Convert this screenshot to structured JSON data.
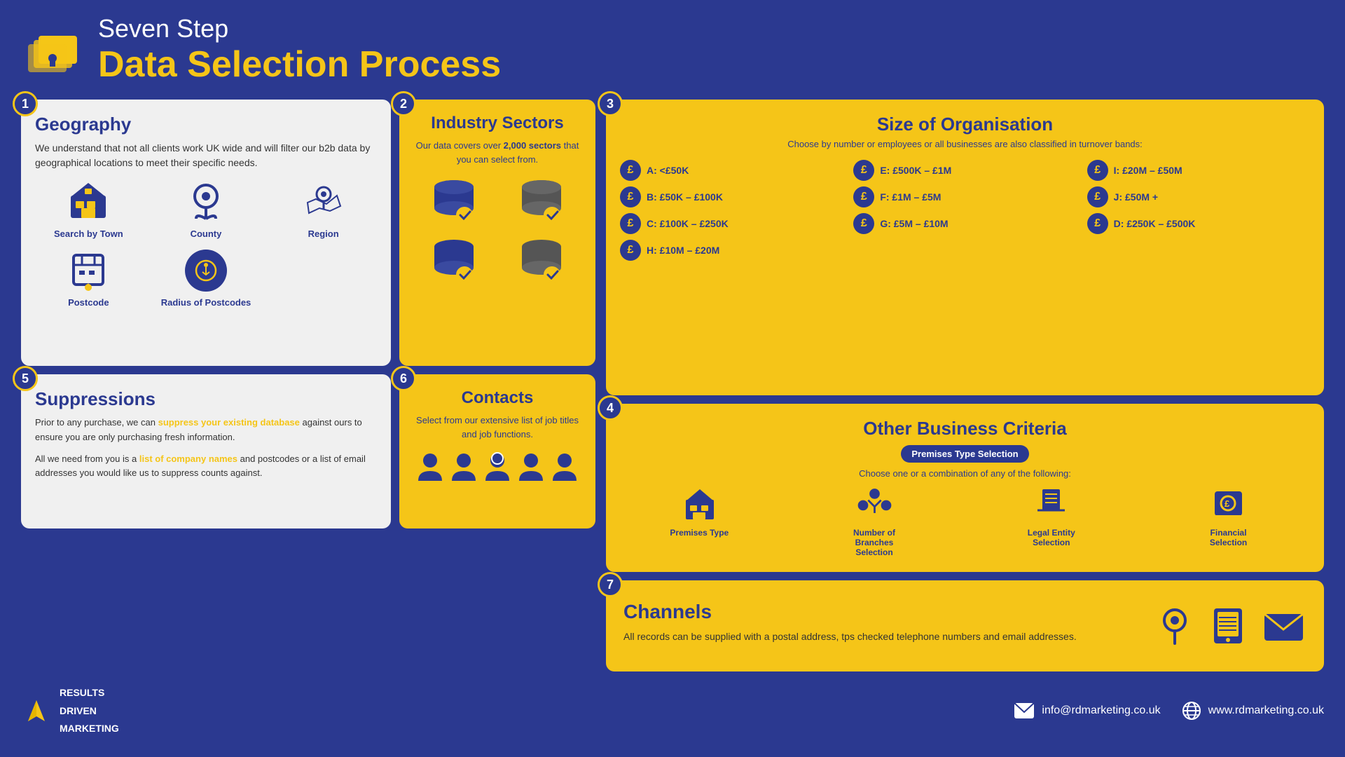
{
  "header": {
    "subtitle": "Seven Step",
    "title": "Data Selection Process"
  },
  "steps": {
    "step1": {
      "number": "1",
      "title": "Geography",
      "description": "We understand that not all clients work UK wide and will filter our b2b data by geographical locations to meet their specific needs.",
      "geo_items": [
        {
          "label": "Search by Town"
        },
        {
          "label": "County"
        },
        {
          "label": "Region"
        },
        {
          "label": "Postcode"
        },
        {
          "label": "Radius of Postcodes"
        }
      ]
    },
    "step2": {
      "number": "2",
      "title": "Industry Sectors",
      "description_pre": "Our data covers over ",
      "description_bold": "2,000 sectors",
      "description_post": " that you can select from."
    },
    "step3": {
      "number": "3",
      "title": "Size of Organisation",
      "subtitle": "Choose by number or employees or all businesses are also classified in turnover bands:",
      "bands": [
        {
          "label": "A: <£50K"
        },
        {
          "label": "B: £50K – £100K"
        },
        {
          "label": "C: £100K – £250K"
        },
        {
          "label": "D: £250K – £500K"
        },
        {
          "label": "E: £500K – £1M"
        },
        {
          "label": "F: £1M – £5M"
        },
        {
          "label": "G: £5M – £10M"
        },
        {
          "label": "H: £10M – £20M"
        },
        {
          "label": "I: £20M – £50M"
        },
        {
          "label": "J: £50M +"
        }
      ]
    },
    "step4": {
      "number": "4",
      "title": "Other Business Criteria",
      "badge": "Premises Type Selection",
      "choose_text": "Choose one or a combination of any of the following:",
      "criteria": [
        {
          "label": "Premises Type"
        },
        {
          "label": "Number of Branches Selection"
        },
        {
          "label": "Legal Entity Selection"
        },
        {
          "label": "Financial Selection"
        }
      ]
    },
    "step5": {
      "number": "5",
      "title": "Suppressions",
      "text1": "Prior to any purchase, we can ",
      "text1_bold": "suppress your existing database",
      "text1_end": " against ours to ensure you are only purchasing fresh information.",
      "text2_pre": "All we need from you is a ",
      "text2_bold": "list of company names",
      "text2_end": " and postcodes or a list of email addresses you would like us to suppress counts against."
    },
    "step6": {
      "number": "6",
      "title": "Contacts",
      "description": "Select from our extensive list of job titles and job functions."
    },
    "step7": {
      "number": "7",
      "title": "Channels",
      "description": "All records can be supplied with a postal address, tps checked telephone numbers and email addresses."
    }
  },
  "footer": {
    "logo_text": "RESULTS\nDRIVEN\nMARKETING",
    "email": "info@rdmarketing.co.uk",
    "website": "www.rdmarketing.co.uk"
  }
}
